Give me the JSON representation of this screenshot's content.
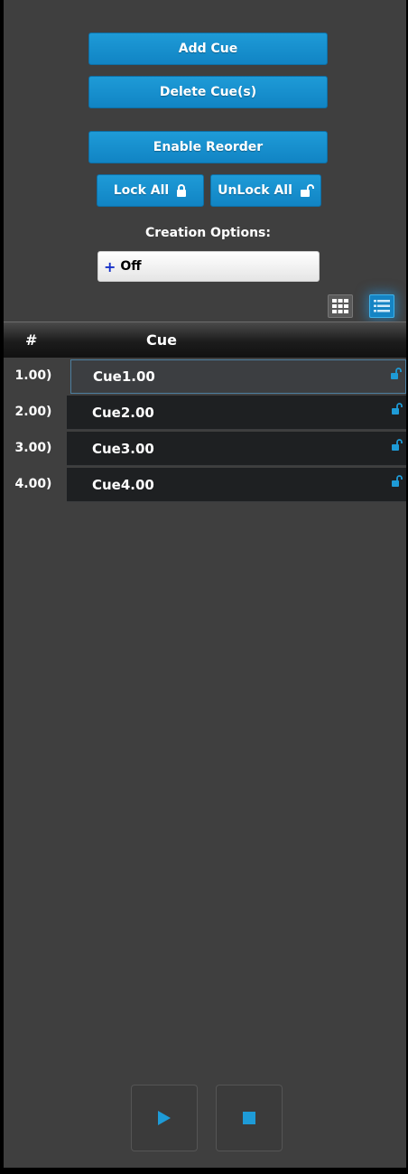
{
  "toolbar": {
    "add_cue": "Add Cue",
    "delete_cues": "Delete Cue(s)",
    "enable_reorder": "Enable Reorder",
    "lock_all": "Lock All",
    "unlock_all": "UnLock All",
    "creation_options_label": "Creation Options:",
    "creation_options_value": "Off",
    "creation_options_prefix": "+"
  },
  "view_toggle": {
    "grid_icon": "grid-view-icon",
    "list_icon": "list-view-icon",
    "active": "list"
  },
  "table": {
    "columns": [
      "#",
      "Cue"
    ],
    "rows": [
      {
        "num": "1.00)",
        "name": "Cue1.00",
        "locked": false,
        "selected": true
      },
      {
        "num": "2.00)",
        "name": "Cue2.00",
        "locked": false,
        "selected": false
      },
      {
        "num": "3.00)",
        "name": "Cue3.00",
        "locked": false,
        "selected": false
      },
      {
        "num": "4.00)",
        "name": "Cue4.00",
        "locked": false,
        "selected": false
      }
    ]
  },
  "transport": {
    "play_icon": "play-icon",
    "stop_icon": "stop-icon"
  },
  "colors": {
    "accent": "#1e9bd7",
    "panel_bg": "#3f3f3f",
    "row_bg": "#1e2022"
  }
}
